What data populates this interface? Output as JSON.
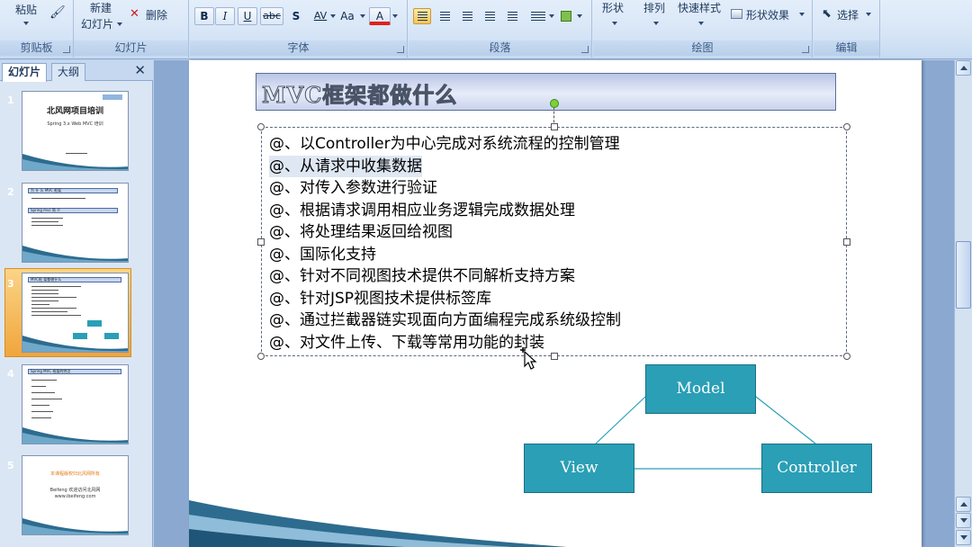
{
  "ribbon": {
    "clipboard": {
      "paste": "粘贴",
      "label": "剪贴板"
    },
    "slides": {
      "new_slide_line1": "新建",
      "new_slide_line2": "幻灯片",
      "delete": "删除",
      "label": "幻灯片"
    },
    "font": {
      "bold": "B",
      "italic": "I",
      "underline": "U",
      "strike": "abc",
      "shadow": "S",
      "spacing": "AV",
      "case": "Aa",
      "color": "A",
      "label": "字体"
    },
    "paragraph": {
      "label": "段落"
    },
    "drawing": {
      "shapes": "形状",
      "arrange": "排列",
      "quick_styles": "快速样式",
      "shape_effects": "形状效果",
      "label": "绘图"
    },
    "editing": {
      "select": "选择",
      "label": "编辑"
    },
    "accent_font_color": "#e02020"
  },
  "pane": {
    "tabs": [
      "幻灯片",
      "大纲"
    ],
    "close": "✕",
    "thumbnails": [
      {
        "num": "1",
        "title": "北风网项目培训",
        "subtitle": "Spring 3.x Web MVC 培训"
      },
      {
        "num": "2",
        "bar1": "为 什 么 MVC 框架",
        "bar2": "Spring mvc 简 介"
      },
      {
        "num": "3",
        "bar1": "MVC框 架都做什么"
      },
      {
        "num": "4",
        "bar1": "Spring MVC 框架的特点"
      },
      {
        "num": "5",
        "orange": "本课程版权归北风网所有",
        "line1": "Beifeng 欢迎访问北风网",
        "line2": "www.ibeifeng.com"
      }
    ]
  },
  "slide": {
    "title": "MVC框架都做什么",
    "bullets": [
      "@、以Controller为中心完成对系统流程的控制管理",
      "@、从请求中收集数据",
      "@、对传入参数进行验证",
      "@、根据请求调用相应业务逻辑完成数据处理",
      "@、将处理结果返回给视图",
      "@、国际化支持",
      "@、针对不同视图技术提供不同解析支持方案",
      "@、针对JSP视图技术提供标签库",
      "@、通过拦截器链实现面向方面编程完成系统级控制",
      "@、对文件上传、下载等常用功能的封装"
    ],
    "diagram": {
      "model": "Model",
      "view": "View",
      "controller": "Controller",
      "node_color": "#2a9fb6"
    }
  }
}
